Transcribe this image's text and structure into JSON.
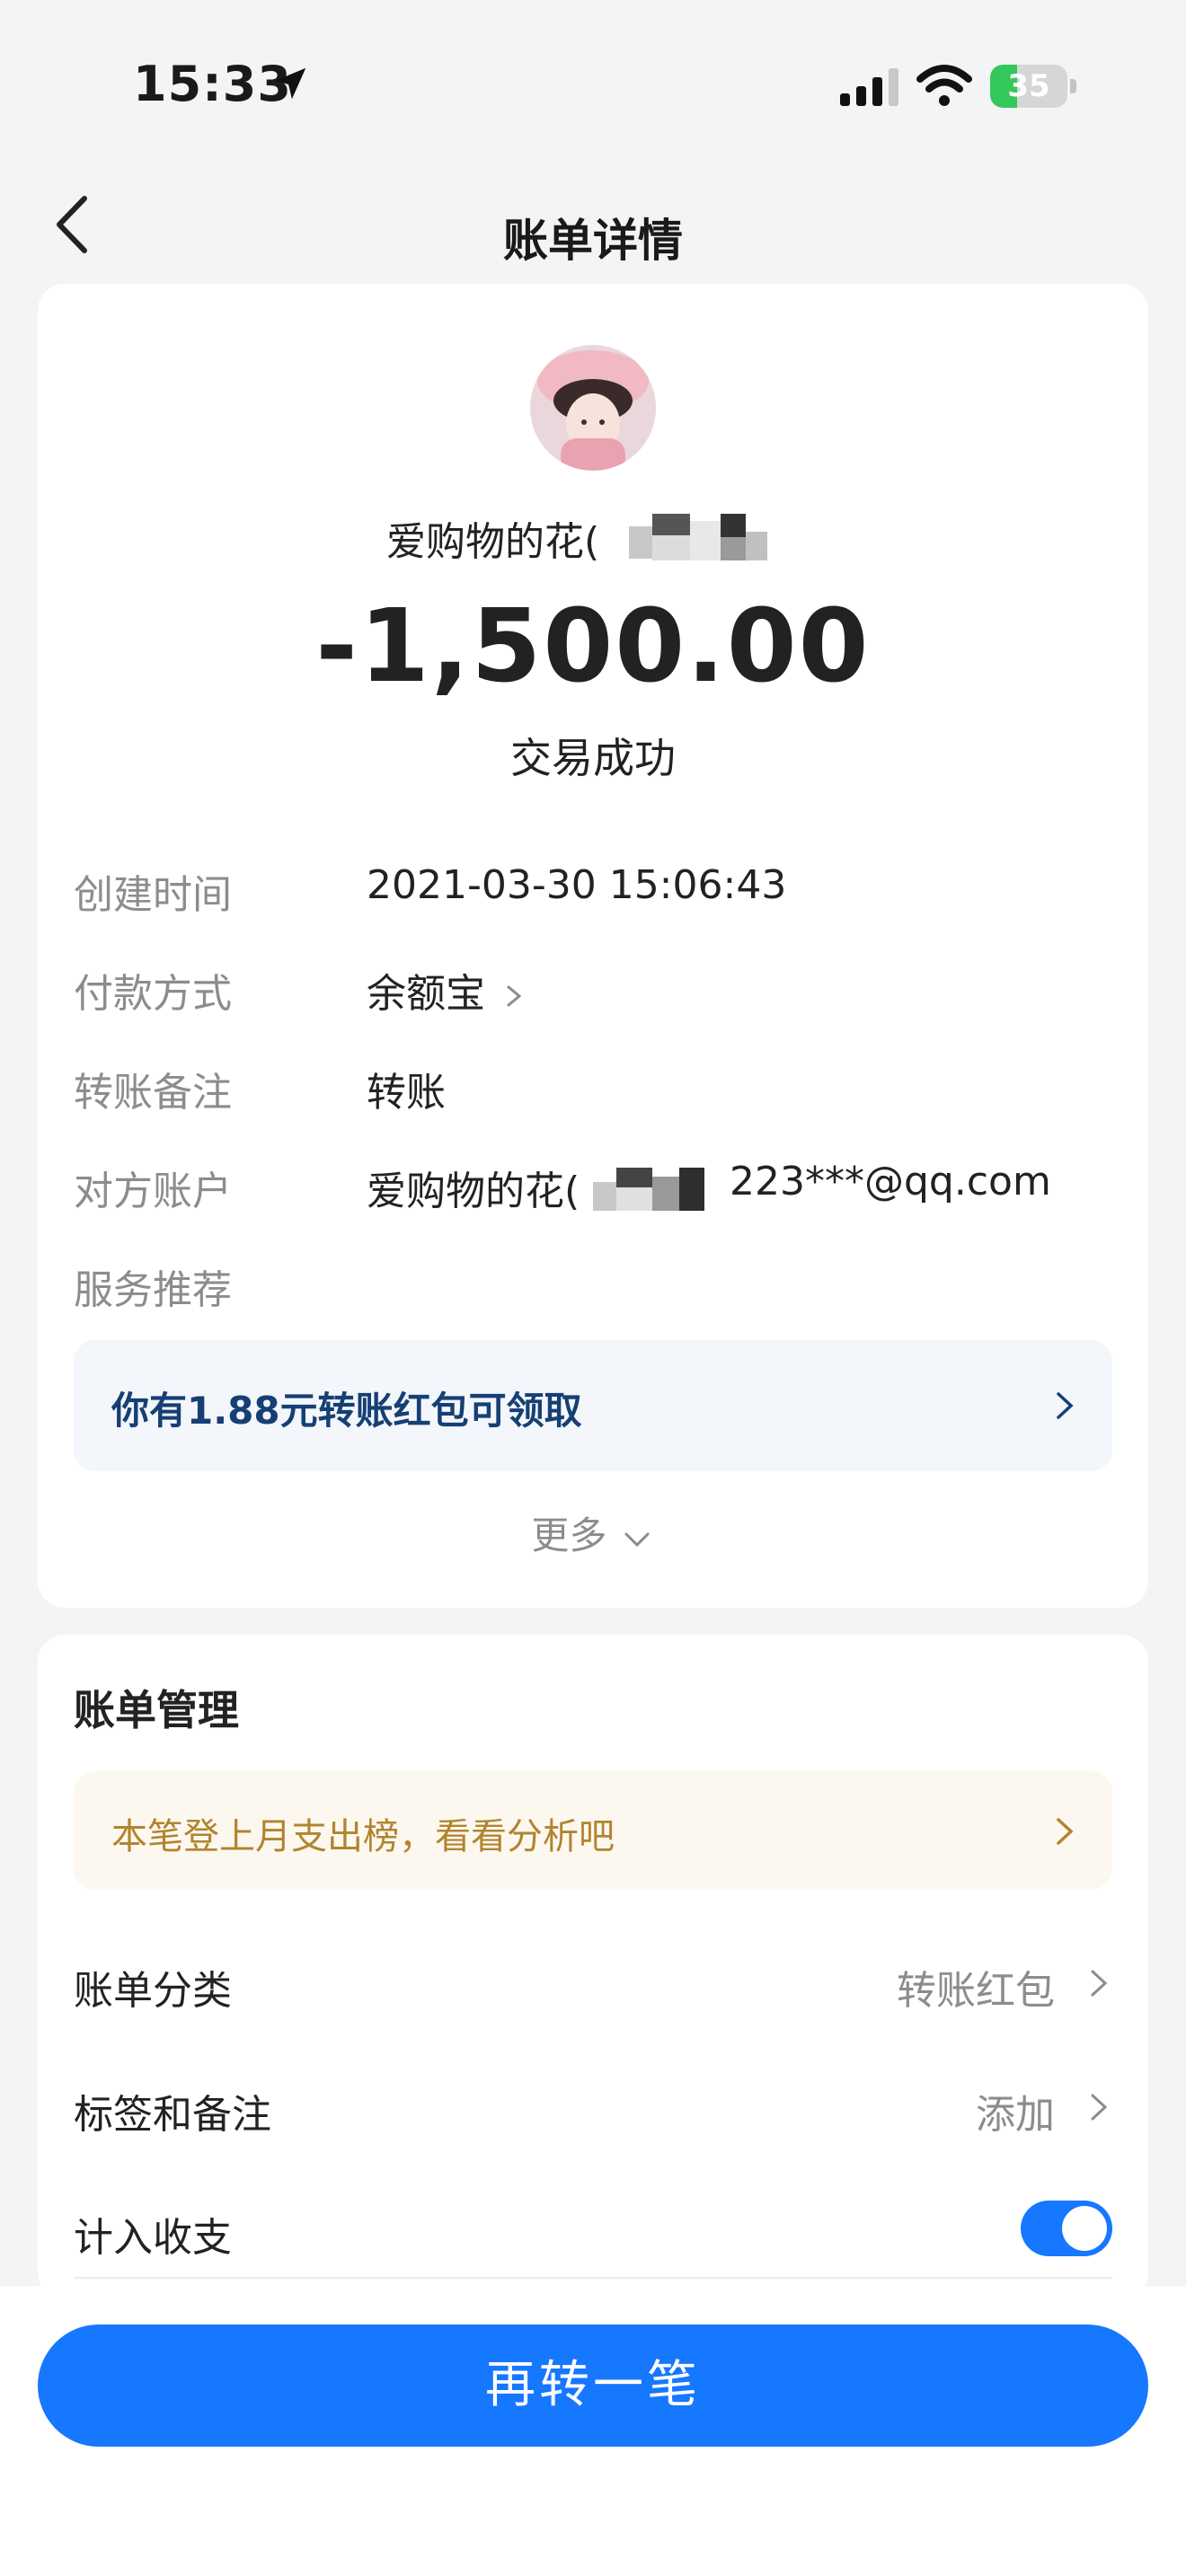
{
  "status_bar": {
    "time": "15:33",
    "battery": "35",
    "battery_level": 0.35
  },
  "nav": {
    "title": "账单详情"
  },
  "transaction": {
    "payee_name": "爱购物的花(",
    "amount": "-1,500.00",
    "status": "交易成功"
  },
  "details": [
    {
      "label": "创建时间",
      "value": "2021-03-30 15:06:43"
    },
    {
      "label": "付款方式",
      "value": "余额宝"
    },
    {
      "label": "转账备注",
      "value": "转账"
    },
    {
      "label": "对方账户",
      "value": "爱购物的花(",
      "value_suffix": "223***@qq.com"
    },
    {
      "label": "服务推荐",
      "value": ""
    }
  ],
  "promo": {
    "text": "你有1.88元转账红包可领取"
  },
  "more": {
    "label": "更多"
  },
  "management": {
    "title": "账单管理",
    "notice": "本笔登上月支出榜，看看分析吧",
    "rows": [
      {
        "label": "账单分类",
        "value": "转账红包"
      },
      {
        "label": "标签和备注",
        "value": "添加"
      },
      {
        "label": "计入收支",
        "toggle": true
      }
    ]
  },
  "cta": {
    "label": "再转一笔"
  },
  "colors": {
    "accent": "#1677ff",
    "promo_text": "#163f74",
    "notice_text": "#b2842f",
    "battery": "#34c759"
  }
}
